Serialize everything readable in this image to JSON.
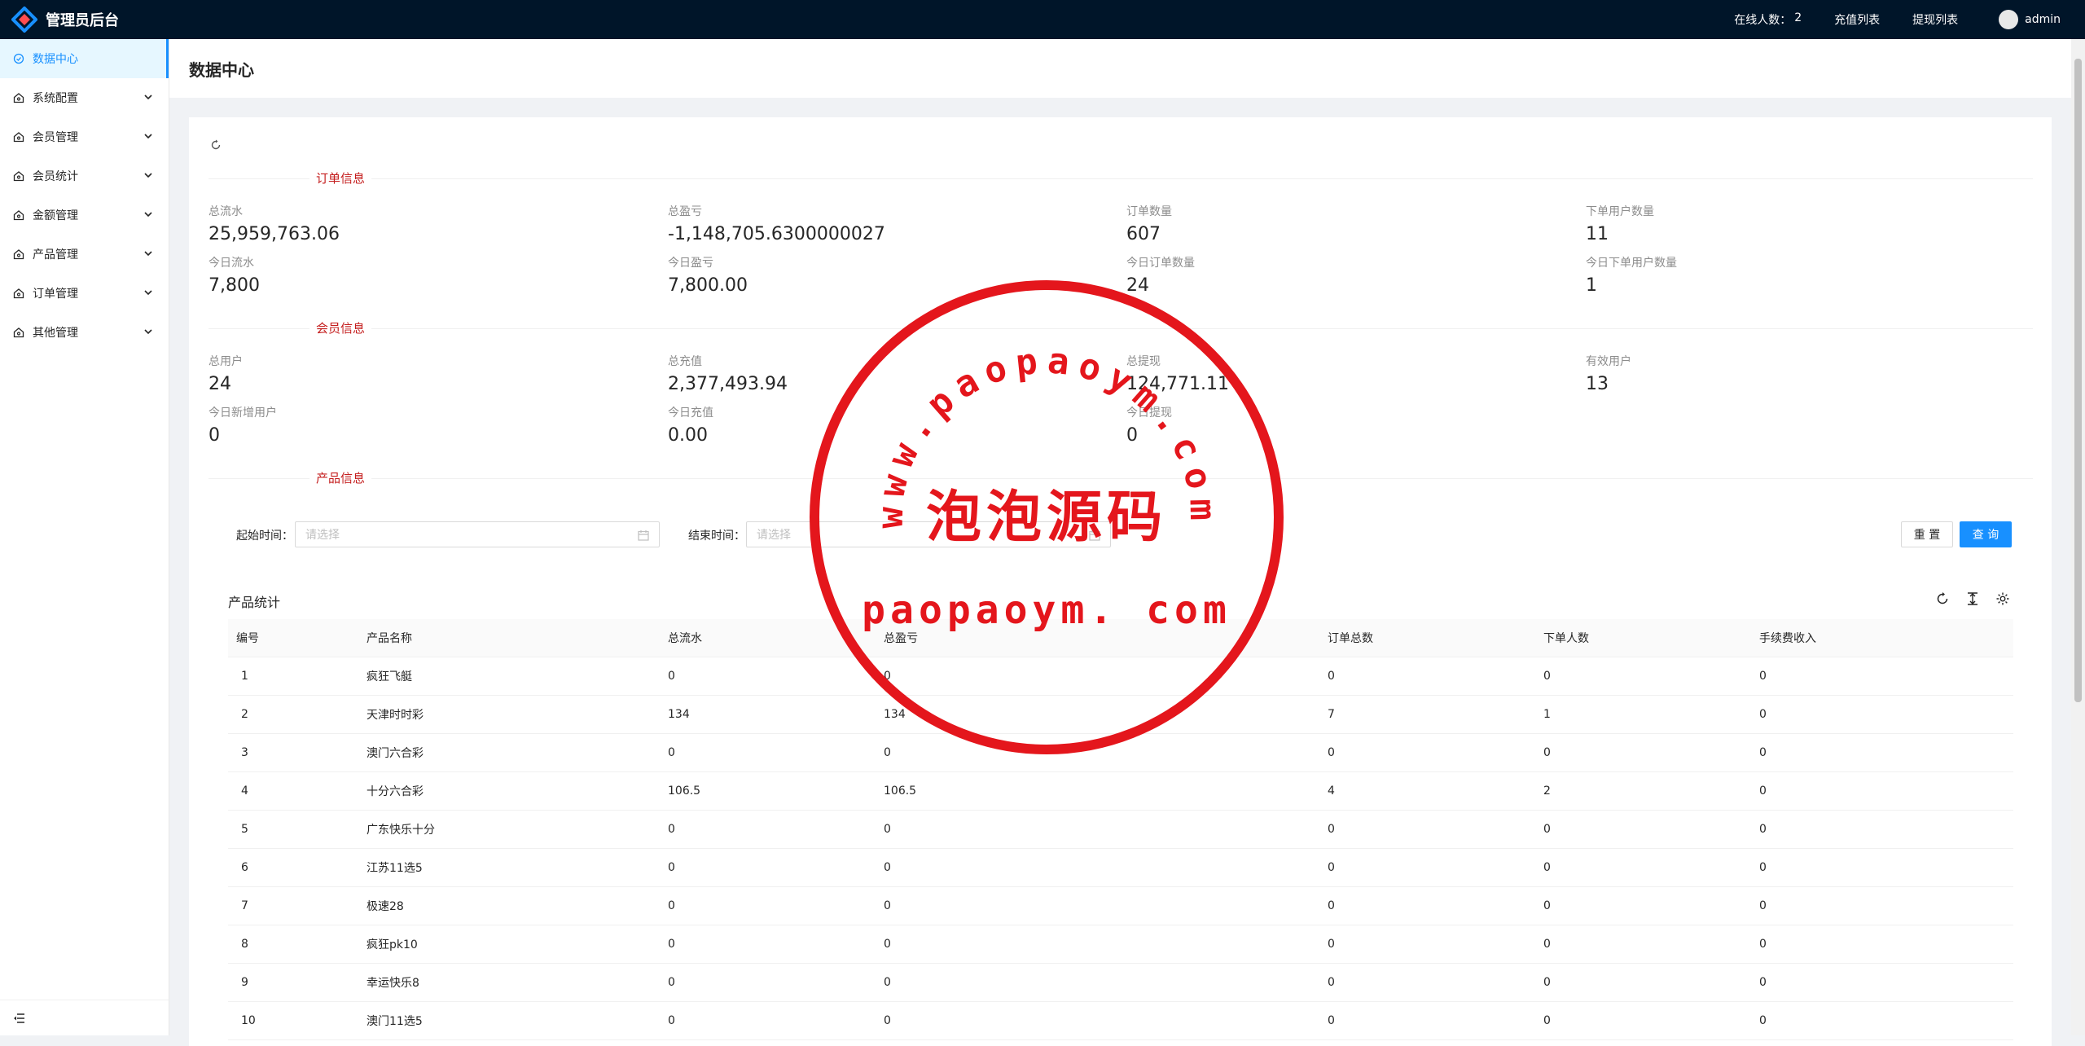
{
  "app": {
    "title": "管理员后台"
  },
  "topbar": {
    "online_label": "在线人数：",
    "online_count": "2",
    "recharge_link": "充值列表",
    "withdraw_link": "提现列表",
    "user_name": "admin"
  },
  "sidebar": {
    "items": [
      {
        "label": "数据中心",
        "active": true
      },
      {
        "label": "系统配置"
      },
      {
        "label": "会员管理"
      },
      {
        "label": "会员统计"
      },
      {
        "label": "金额管理"
      },
      {
        "label": "产品管理"
      },
      {
        "label": "订单管理"
      },
      {
        "label": "其他管理"
      }
    ]
  },
  "page": {
    "title": "数据中心"
  },
  "sections": {
    "order": "订单信息",
    "member": "会员信息",
    "product": "产品信息"
  },
  "order_stats": {
    "total_flow": {
      "label": "总流水",
      "value": "25,959,763.06"
    },
    "total_profit": {
      "label": "总盈亏",
      "value": "-1,148,705.6300000027"
    },
    "order_count": {
      "label": "订单数量",
      "value": "607"
    },
    "order_users": {
      "label": "下单用户数量",
      "value": "11"
    },
    "today_flow": {
      "label": "今日流水",
      "value": "7,800"
    },
    "today_profit": {
      "label": "今日盈亏",
      "value": "7,800.00"
    },
    "today_orders": {
      "label": "今日订单数量",
      "value": "24"
    },
    "today_order_users": {
      "label": "今日下单用户数量",
      "value": "1"
    }
  },
  "member_stats": {
    "total_users": {
      "label": "总用户",
      "value": "24"
    },
    "total_recharge": {
      "label": "总充值",
      "value": "2,377,493.94"
    },
    "total_withdraw": {
      "label": "总提现",
      "value": "124,771.11"
    },
    "valid_users": {
      "label": "有效用户",
      "value": "13"
    },
    "today_new_users": {
      "label": "今日新增用户",
      "value": "0"
    },
    "today_recharge": {
      "label": "今日充值",
      "value": "0.00"
    },
    "today_withdraw": {
      "label": "今日提现",
      "value": "0"
    }
  },
  "filters": {
    "start_label": "起始时间：",
    "start_placeholder": "请选择",
    "end_label": "结束时间：",
    "end_placeholder": "请选择",
    "reset": "重 置",
    "query": "查 询"
  },
  "table": {
    "title": "产品统计",
    "columns": [
      "编号",
      "产品名称",
      "总流水",
      "总盈亏",
      "订单总数",
      "下单人数",
      "手续费收入"
    ],
    "rows": [
      [
        "1",
        "疯狂飞艇",
        "0",
        "0",
        "0",
        "0",
        "0"
      ],
      [
        "2",
        "天津时时彩",
        "134",
        "134",
        "7",
        "1",
        "0"
      ],
      [
        "3",
        "澳门六合彩",
        "0",
        "0",
        "0",
        "0",
        "0"
      ],
      [
        "4",
        "十分六合彩",
        "106.5",
        "106.5",
        "4",
        "2",
        "0"
      ],
      [
        "5",
        "广东快乐十分",
        "0",
        "0",
        "0",
        "0",
        "0"
      ],
      [
        "6",
        "江苏11选5",
        "0",
        "0",
        "0",
        "0",
        "0"
      ],
      [
        "7",
        "极速28",
        "0",
        "0",
        "0",
        "0",
        "0"
      ],
      [
        "8",
        "疯狂pk10",
        "0",
        "0",
        "0",
        "0",
        "0"
      ],
      [
        "9",
        "幸运快乐8",
        "0",
        "0",
        "0",
        "0",
        "0"
      ],
      [
        "10",
        "澳门11选5",
        "0",
        "0",
        "0",
        "0",
        "0"
      ]
    ]
  },
  "watermark": {
    "arc_text": "www.paopaoym.com",
    "main_text": "泡泡源码",
    "bottom_text": "paopaoym. com",
    "color": "#e4161c"
  },
  "colors": {
    "primary": "#1890ff",
    "header_bg": "#001529",
    "section_label": "#c41d1d"
  }
}
